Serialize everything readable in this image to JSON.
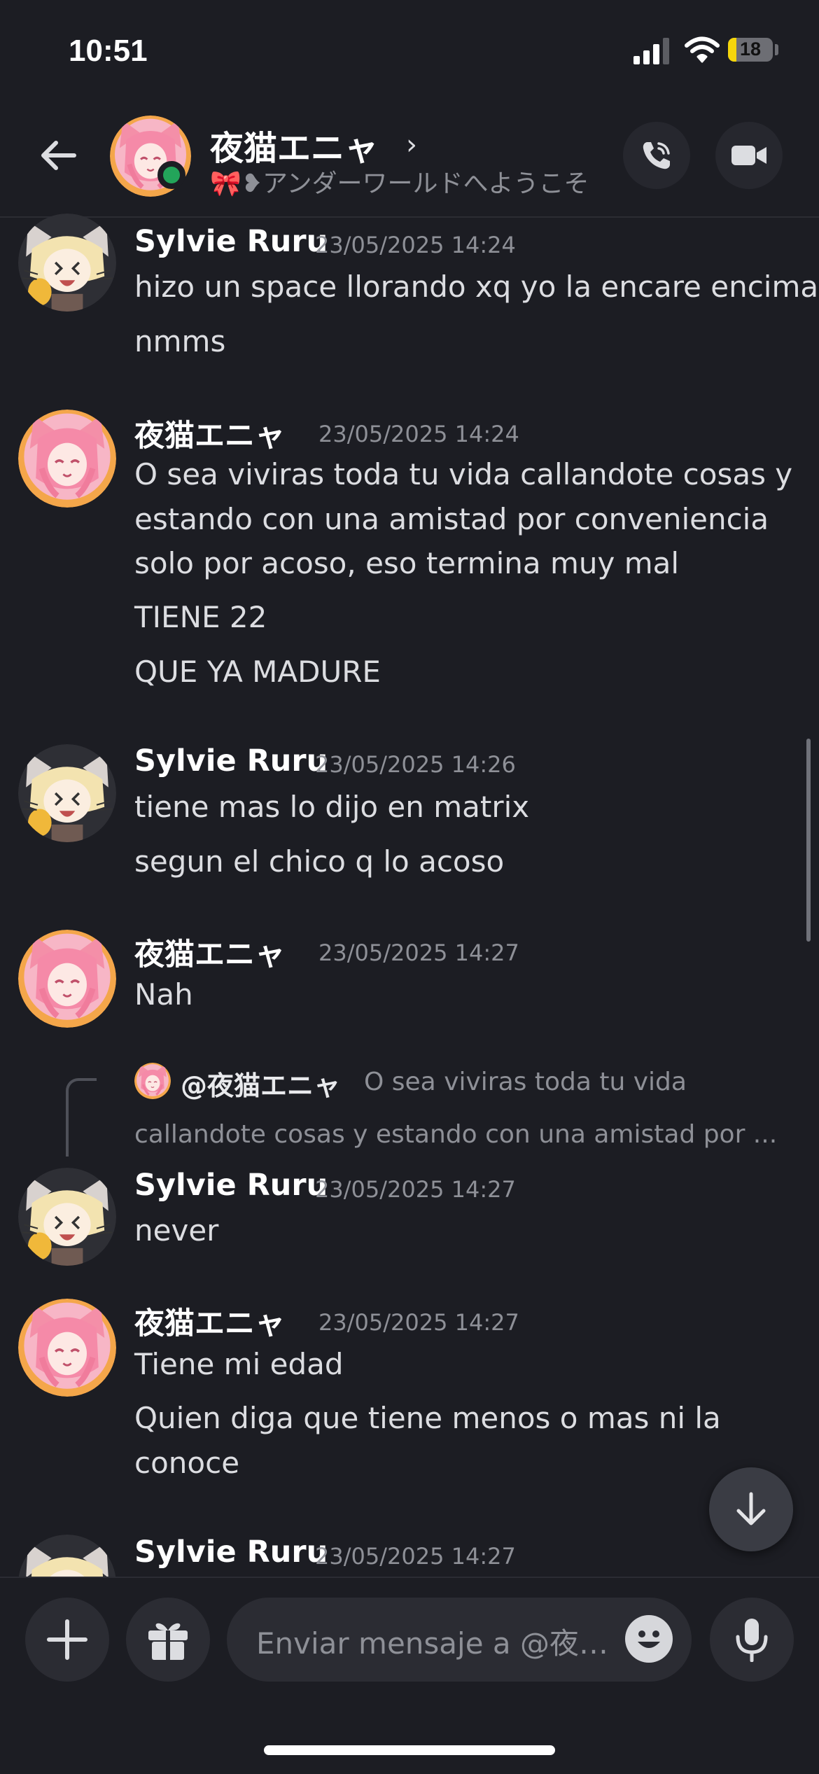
{
  "status_bar": {
    "time": "10:51",
    "battery": "18",
    "battery_level": 0.18
  },
  "header": {
    "name": "夜猫エニャ",
    "chevron": "›",
    "status_emoji": "🎀",
    "status_text": "❥アンダーワールドへようこそ",
    "buttons": [
      "back-icon",
      "voice-call-icon",
      "video-call-icon"
    ]
  },
  "messages": [
    {
      "author": "Sylvie Ruru",
      "timestamp": "23/05/2025 14:24",
      "lines": [
        "hizo un space llorando xq yo la encare encima",
        "nmms"
      ]
    },
    {
      "author": "夜猫エニャ",
      "timestamp": "23/05/2025 14:24",
      "lines": [
        "O sea viviras toda tu vida callandote cosas y",
        "estando con una amistad por conveniencia",
        "solo por acoso, eso termina muy mal",
        "TIENE 22",
        "QUE YA MADURE"
      ]
    },
    {
      "author": "Sylvie Ruru",
      "timestamp": "23/05/2025 14:26",
      "lines": [
        "tiene mas lo dijo en matrix",
        "segun el chico q lo acoso"
      ]
    },
    {
      "author": "夜猫エニャ",
      "timestamp": "23/05/2025 14:27",
      "lines": [
        "Nah"
      ]
    },
    {
      "author": "Sylvie Ruru",
      "timestamp": "23/05/2025 14:27",
      "reply": {
        "author": "@夜猫エニャ",
        "preview_1": "O sea viviras toda tu vida",
        "preview_2": "callandote cosas y estando con una amistad por ..."
      },
      "lines": [
        "never"
      ]
    },
    {
      "author": "夜猫エニャ",
      "timestamp": "23/05/2025 14:27",
      "lines": [
        "Tiene mi edad",
        "Quien diga que tiene menos o mas ni la",
        "conoce"
      ]
    },
    {
      "author": "Sylvie Ruru",
      "timestamp": "23/05/2025 14:27",
      "lines": []
    }
  ],
  "composer": {
    "placeholder": "Enviar mensaje a @夜…",
    "icons": [
      "plus-icon",
      "gift-icon",
      "emoji-icon",
      "microphone-icon"
    ]
  },
  "colors": {
    "background": "#1c1d23",
    "online": "#23a55a",
    "battery": "#f5d60b",
    "avatar_pink": "#f48fa8",
    "avatar_blonde": "#f3e3b0"
  }
}
